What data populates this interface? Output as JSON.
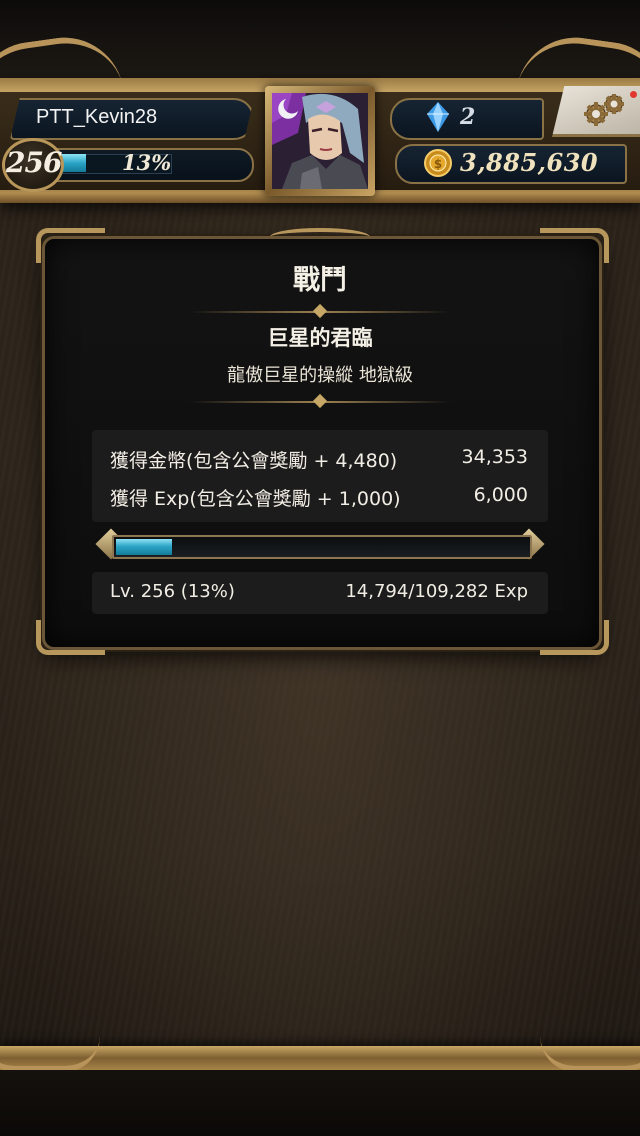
{
  "player": {
    "name": "PTT_Kevin28",
    "level": "256",
    "exp_percent_text": "13%",
    "exp_fraction": 0.13
  },
  "currency": {
    "gems": "2",
    "coins": "3,885,630"
  },
  "result": {
    "title": "戰鬥",
    "stage_name": "巨星的君臨",
    "stage_subtitle": "龍傲巨星的操縱 地獄級",
    "rewards": [
      {
        "label": "獲得金幣(包含公會獎勵 + 4,480)",
        "value": "34,353"
      },
      {
        "label": "獲得 Exp(包含公會獎勵 + 1,000)",
        "value": "6,000"
      }
    ],
    "level_text": "Lv. 256 (13%)",
    "exp_text": "14,794/109,282 Exp",
    "exp_fraction": 0.135
  },
  "colors": {
    "accent_bar": "#2ea6c7",
    "gold_frame": "#b8975d",
    "notification": "#e2372e"
  },
  "icons": {
    "gem": "blue-crystal-icon",
    "coin": "gold-coin-icon",
    "settings": "gears-icon"
  }
}
